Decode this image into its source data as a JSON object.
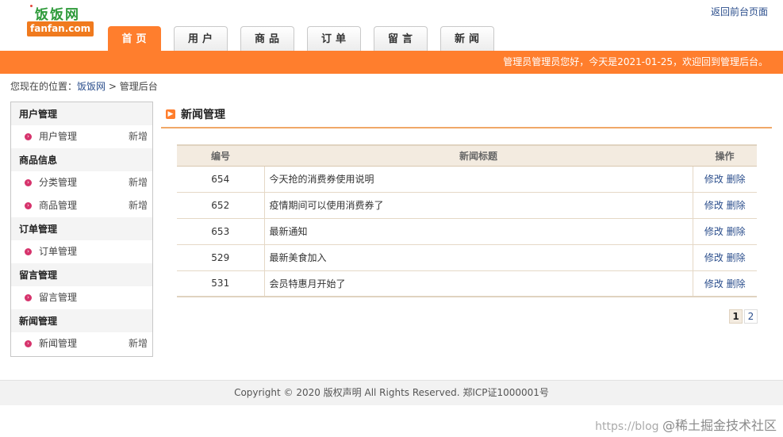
{
  "logo": {
    "cn": "饭饭网",
    "en": "fanfan.com"
  },
  "header": {
    "back_link": "返回前台页面"
  },
  "nav": {
    "tabs": [
      "首页",
      "用户",
      "商品",
      "订单",
      "留言",
      "新闻"
    ]
  },
  "welcome_text": "管理员管理员您好，今天是2021-01-25，欢迎回到管理后台。",
  "breadcrumb": {
    "prefix": "您现在的位置：",
    "home": "饭饭网",
    "sep": ">",
    "current": "管理后台"
  },
  "sidebar": {
    "add_label": "新增",
    "groups": [
      {
        "title": "用户管理",
        "items": [
          {
            "label": "用户管理",
            "add": true
          }
        ]
      },
      {
        "title": "商品信息",
        "items": [
          {
            "label": "分类管理",
            "add": true
          },
          {
            "label": "商品管理",
            "add": true
          }
        ]
      },
      {
        "title": "订单管理",
        "items": [
          {
            "label": "订单管理",
            "add": false
          }
        ]
      },
      {
        "title": "留言管理",
        "items": [
          {
            "label": "留言管理",
            "add": false
          }
        ]
      },
      {
        "title": "新闻管理",
        "items": [
          {
            "label": "新闻管理",
            "add": true
          }
        ]
      }
    ]
  },
  "main": {
    "title": "新闻管理",
    "table": {
      "headers": [
        "编号",
        "新闻标题",
        "操作"
      ],
      "edit_label": "修改",
      "delete_label": "删除",
      "rows": [
        {
          "id": "654",
          "title": "今天抢的消费券使用说明"
        },
        {
          "id": "652",
          "title": "疫情期间可以使用消费券了"
        },
        {
          "id": "653",
          "title": "最新通知"
        },
        {
          "id": "529",
          "title": "最新美食加入"
        },
        {
          "id": "531",
          "title": "会员特惠月开始了"
        }
      ]
    },
    "pager": {
      "pages": [
        "1",
        "2"
      ],
      "current": "1"
    }
  },
  "footer": {
    "copyright": "Copyright © 2020 版权声明 All Rights Reserved. 郑ICP证1000001号"
  },
  "watermark": {
    "url": "https://blog",
    "text": "@稀土掘金技术社区"
  },
  "colors": {
    "accent": "#ff7e2d",
    "link": "#2b4e8c",
    "logo_green": "#2e9a3a"
  }
}
